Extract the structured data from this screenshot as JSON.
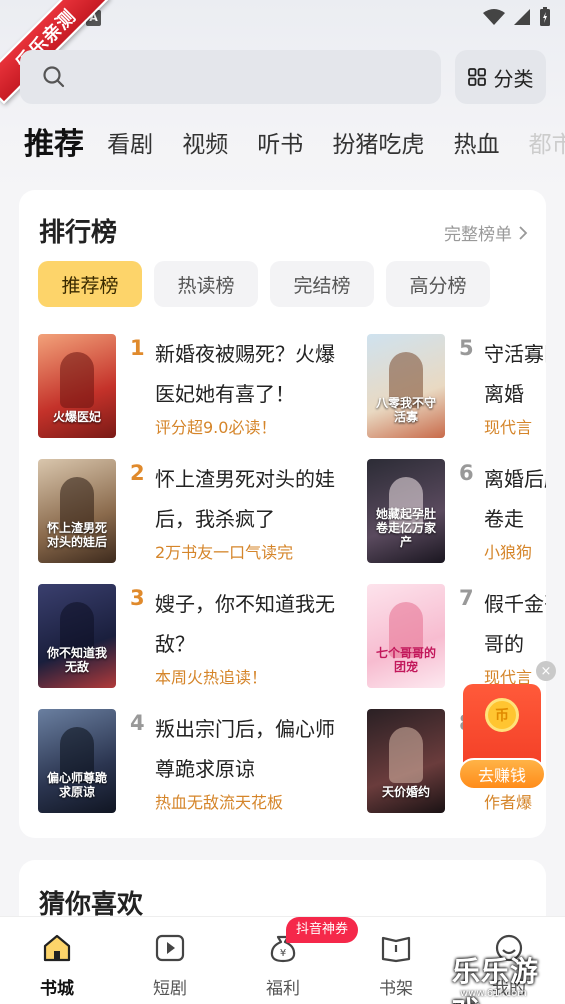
{
  "watermark": {
    "corner": "乐乐亲测",
    "brand": "乐乐游戏",
    "url": "www.61i.com"
  },
  "status": {
    "app_icon": "A"
  },
  "search": {
    "placeholder": "",
    "category_label": "分类"
  },
  "tabs": [
    "推荐",
    "看剧",
    "视频",
    "听书",
    "扮猪吃虎",
    "热血",
    "都市"
  ],
  "ranking": {
    "title": "排行榜",
    "more_label": "完整榜单",
    "filters": [
      "推荐榜",
      "热读榜",
      "完结榜",
      "高分榜"
    ],
    "books": [
      {
        "rank": "1",
        "title": "新婚夜被赐死？火爆医妃她有喜了！",
        "tag": "评分超9.0必读！",
        "cover_text": "火爆医妃"
      },
      {
        "rank": "2",
        "title": "怀上渣男死对头的娃后，我杀疯了",
        "tag": "2万书友一口气读完",
        "cover_text": "怀上渣男死对头的娃后"
      },
      {
        "rank": "3",
        "title": "嫂子，你不知道我无敌？",
        "tag": "本周火热追读！",
        "cover_text": "你不知道我无敌"
      },
      {
        "rank": "4",
        "title": "叛出宗门后，偏心师尊跪求原谅",
        "tag": "热血无敌流天花板",
        "cover_text": "偏心师尊跪求原谅"
      },
      {
        "rank": "5",
        "title": "守活寡区离婚",
        "tag": "现代言",
        "cover_text": "八零我不守活寡"
      },
      {
        "rank": "6",
        "title": "离婚后肚卷走",
        "tag": "小狼狗",
        "cover_text": "她藏起孕肚卷走亿万家产"
      },
      {
        "rank": "7",
        "title": "假千金哥哥的",
        "tag": "现代言",
        "cover_text": "七个哥哥的团宠"
      },
      {
        "rank": "8",
        "title": "",
        "tag": "作者爆",
        "cover_text": "天价婚约"
      }
    ]
  },
  "guess": {
    "title": "猜你喜欢"
  },
  "float": {
    "coin": "币",
    "earn_label": "去赚钱",
    "close": "×"
  },
  "nav": {
    "items": [
      "书城",
      "短剧",
      "福利",
      "书架",
      "我的"
    ],
    "badge": "抖音神券"
  },
  "colors": {
    "accent": "#fdd46a",
    "tag": "#d5852a",
    "rank_top": "#e08a2c",
    "rank_other": "#999999"
  }
}
